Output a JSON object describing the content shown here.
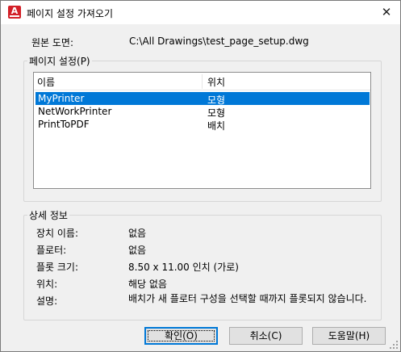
{
  "window": {
    "title": "페이지 설정 가져오기",
    "close_glyph": "✕",
    "app_icon_letter": "A",
    "accent_color": "#0078d7",
    "app_icon_color": "#d32028"
  },
  "source": {
    "label": "원본 도면:",
    "value": "C:\\All Drawings\\test_page_setup.dwg"
  },
  "page_setups": {
    "group_label": "페이지 설정(P)",
    "columns": [
      "이름",
      "위치"
    ],
    "rows": [
      {
        "name": "MyPrinter",
        "location": "모형",
        "selected": true
      },
      {
        "name": "NetWorkPrinter",
        "location": "모형",
        "selected": false
      },
      {
        "name": "PrintToPDF",
        "location": "배치",
        "selected": false
      }
    ]
  },
  "details": {
    "group_label": "상세 정보",
    "items": [
      {
        "label": "장치 이름:",
        "value": "없음"
      },
      {
        "label": "플로터:",
        "value": "없음"
      },
      {
        "label": "플롯 크기:",
        "value": "8.50 x 11.00 인치 (가로)"
      },
      {
        "label": "위치:",
        "value": "해당 없음"
      },
      {
        "label": "설명:",
        "value": "배치가 새 플로터 구성을 선택할 때까지 플롯되지 않습니다."
      }
    ]
  },
  "buttons": {
    "ok": "확인(O)",
    "cancel": "취소(C)",
    "help": "도움말(H)"
  }
}
